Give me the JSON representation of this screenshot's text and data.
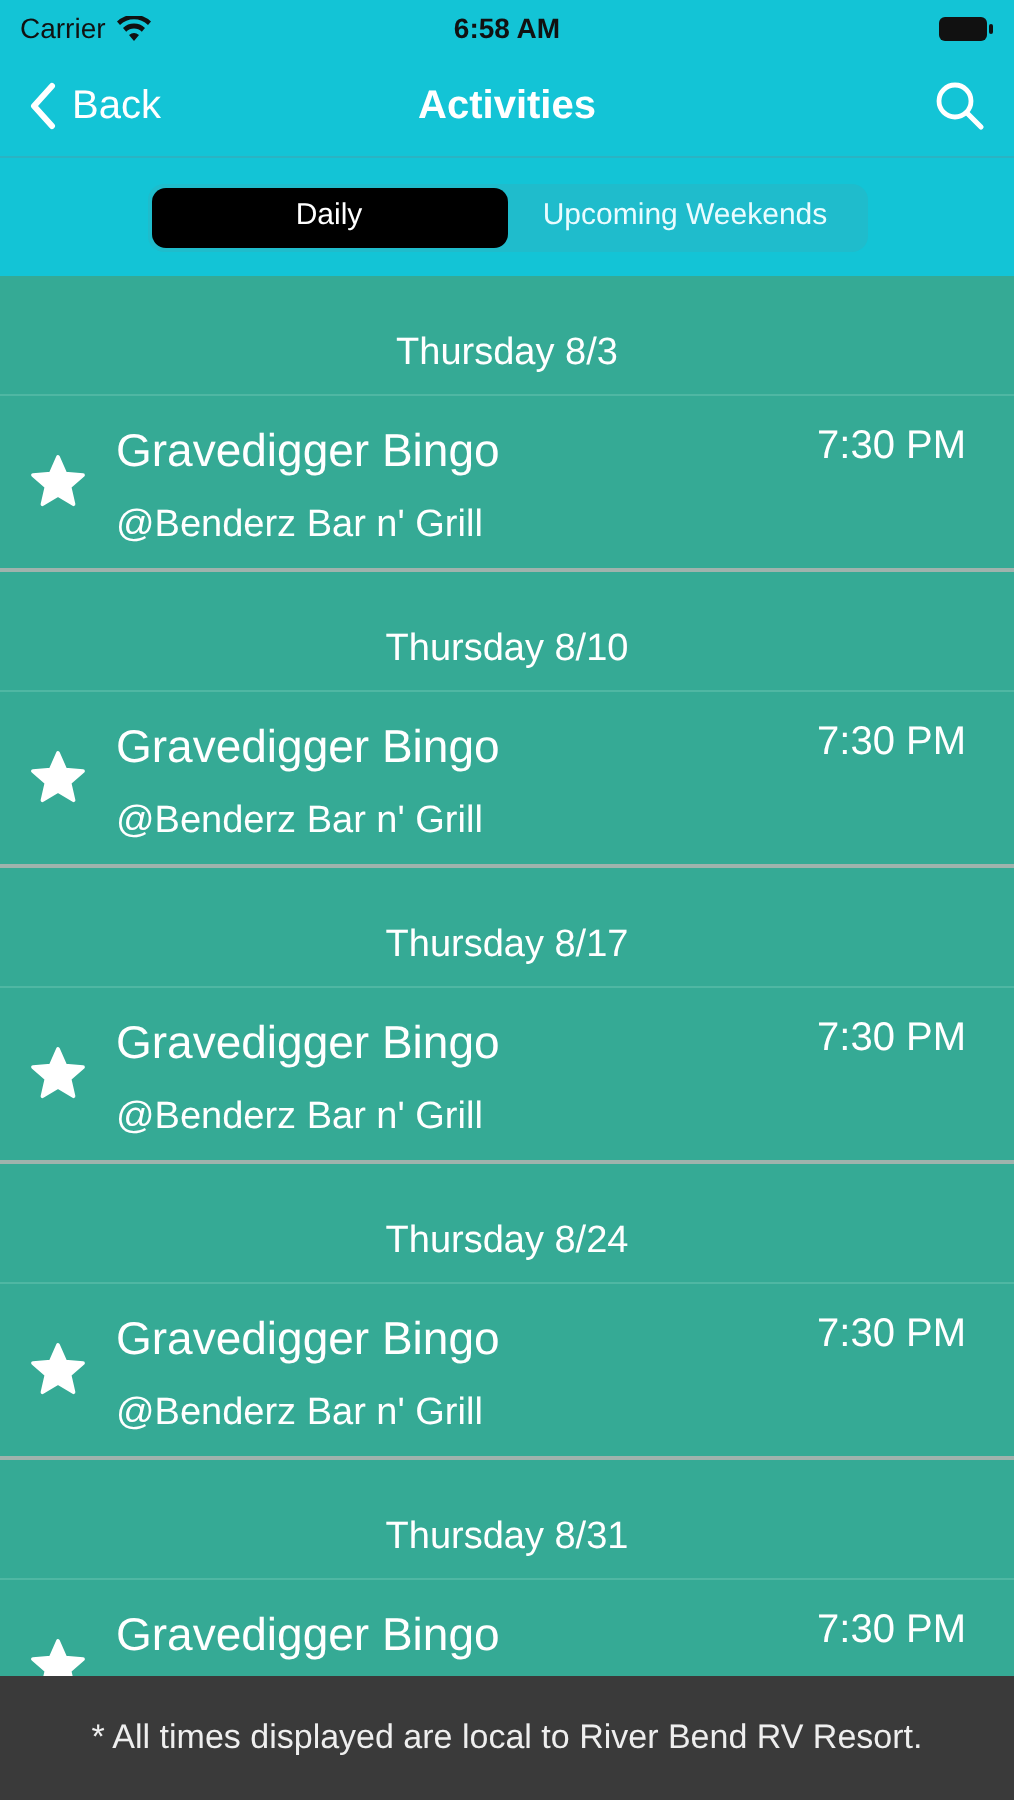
{
  "status_bar": {
    "carrier": "Carrier",
    "time": "6:58 AM"
  },
  "nav": {
    "back": "Back",
    "title": "Activities"
  },
  "segments": [
    {
      "label": "Daily",
      "selected": true
    },
    {
      "label": "Upcoming Weekends",
      "selected": false
    }
  ],
  "sections": [
    {
      "date": "Thursday 8/3",
      "events": [
        {
          "title": "Gravedigger Bingo",
          "venue": "@Benderz Bar n' Grill",
          "time": "7:30 PM",
          "starred": true
        }
      ]
    },
    {
      "date": "Thursday 8/10",
      "events": [
        {
          "title": "Gravedigger Bingo",
          "venue": "@Benderz Bar n' Grill",
          "time": "7:30 PM",
          "starred": true
        }
      ]
    },
    {
      "date": "Thursday 8/17",
      "events": [
        {
          "title": "Gravedigger Bingo",
          "venue": "@Benderz Bar n' Grill",
          "time": "7:30 PM",
          "starred": true
        }
      ]
    },
    {
      "date": "Thursday 8/24",
      "events": [
        {
          "title": "Gravedigger Bingo",
          "venue": "@Benderz Bar n' Grill",
          "time": "7:30 PM",
          "starred": true
        }
      ]
    },
    {
      "date": "Thursday 8/31",
      "events": [
        {
          "title": "Gravedigger Bingo",
          "time": "7:30 PM",
          "starred": true
        }
      ]
    }
  ],
  "footer": "* All times displayed are local to River Bend RV Resort."
}
